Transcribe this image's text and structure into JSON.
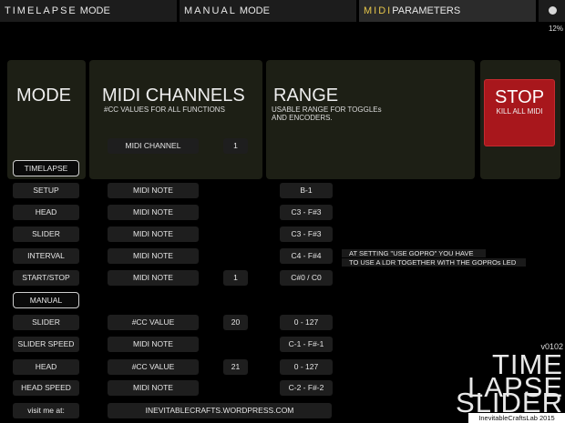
{
  "tabs": {
    "timelapse": {
      "spaced": "TIMELAPSE",
      "rest": " MODE"
    },
    "manual": {
      "spaced": "MANUAL",
      "rest": " MODE"
    },
    "midi": {
      "spaced": "MIDI",
      "rest": "PARAMETERS"
    }
  },
  "battery_percent": "12%",
  "panels": {
    "mode": {
      "title": "MODE"
    },
    "channels": {
      "title": "MIDI CHANNELS",
      "subtitle": "#CC VALUES FOR ALL FUNCTIONS",
      "channel_label": "MIDI CHANNEL",
      "channel_value": "1"
    },
    "range": {
      "title": "RANGE",
      "subtitle_line1": "USABLE RANGE FOR TOGGLEs",
      "subtitle_line2": "AND ENCODERS."
    },
    "stop": {
      "title": "STOP",
      "subtitle": "KILL ALL MIDI"
    }
  },
  "sections": {
    "timelapse": "TIMELAPSE",
    "manual": "MANUAL"
  },
  "rows": [
    {
      "label": "SETUP",
      "type": "MIDI NOTE",
      "channel": "",
      "range": "B-1"
    },
    {
      "label": "HEAD",
      "type": "MIDI NOTE",
      "channel": "",
      "range": "C3 - F#3"
    },
    {
      "label": "SLIDER",
      "type": "MIDI NOTE",
      "channel": "",
      "range": "C3 - F#3"
    },
    {
      "label": "INTERVAL",
      "type": "MIDI NOTE",
      "channel": "",
      "range": "C4 - F#4"
    },
    {
      "label": "START/STOP",
      "type": "MIDI NOTE",
      "channel": "1",
      "range": "C#0 / C0"
    },
    {
      "label": "SLIDER",
      "type": "#CC VALUE",
      "channel": "20",
      "range": "0 - 127"
    },
    {
      "label": "SLIDER SPEED",
      "type": "MIDI NOTE",
      "channel": "",
      "range": "C-1 - F#-1"
    },
    {
      "label": "HEAD",
      "type": "#CC VALUE",
      "channel": "21",
      "range": "0 - 127"
    },
    {
      "label": "HEAD SPEED",
      "type": "MIDI NOTE",
      "channel": "",
      "range": "C-2 - F#-2"
    }
  ],
  "note": {
    "line1": "AT SETTING \"USE GOPRO\" YOU HAVE",
    "line2": "TO USE A LDR TOGETHER WITH THE GOPROs LED"
  },
  "visit": {
    "label": "visit me at:",
    "url": "INEVITABLECRAFTS.WORDPRESS.COM"
  },
  "branding": {
    "version": "v0102",
    "line1": "TIME",
    "line2": "LAPSE",
    "line3": "SLIDER",
    "footer": "InevitableCraftsLab 2015"
  },
  "colors": {
    "accent": "#e5c54a",
    "stop": "#a8171c",
    "panel": "#1d1f15"
  }
}
